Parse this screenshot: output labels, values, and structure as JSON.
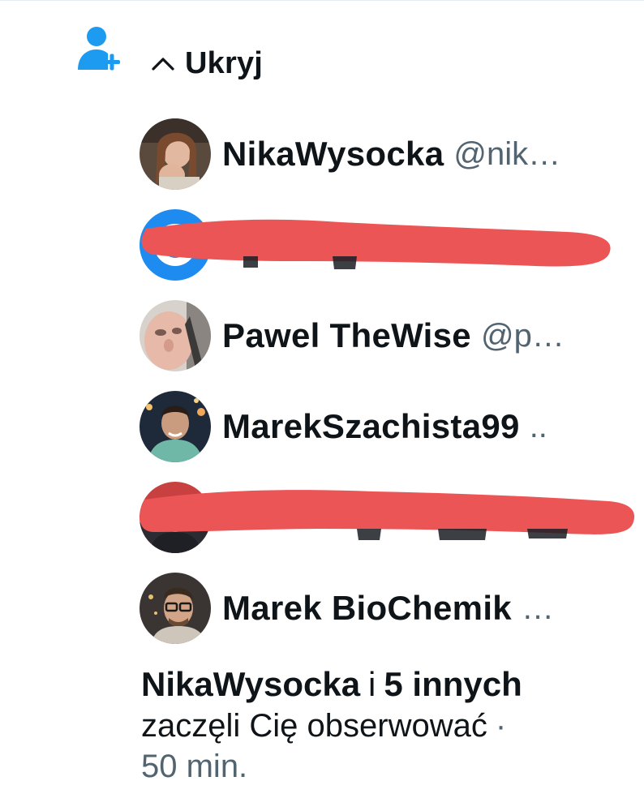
{
  "notification": {
    "type_icon": "person-plus-icon",
    "accent_color": "#1d9bf0",
    "toggle": {
      "icon": "chevron-up-icon",
      "label": "Ukryj"
    },
    "followers": [
      {
        "name": "NikaWysocka",
        "handle": "@nik…",
        "redacted": false
      },
      {
        "name": "",
        "handle": "",
        "redacted": true
      },
      {
        "name": "Pawel TheWise",
        "handle": "@p…",
        "redacted": false
      },
      {
        "name": "MarekSzachista99",
        "handle": "..",
        "redacted": false
      },
      {
        "name": "",
        "handle": "",
        "redacted": true
      },
      {
        "name": "Marek BioChemik",
        "handle": "…",
        "redacted": false
      }
    ],
    "redaction_color": "#ea5455",
    "summary": {
      "actor": "NikaWysocka",
      "conjunction": "i",
      "others": "5 innych",
      "action": "zaczęli Cię obserwować",
      "separator": "·",
      "time": "50 min."
    }
  }
}
